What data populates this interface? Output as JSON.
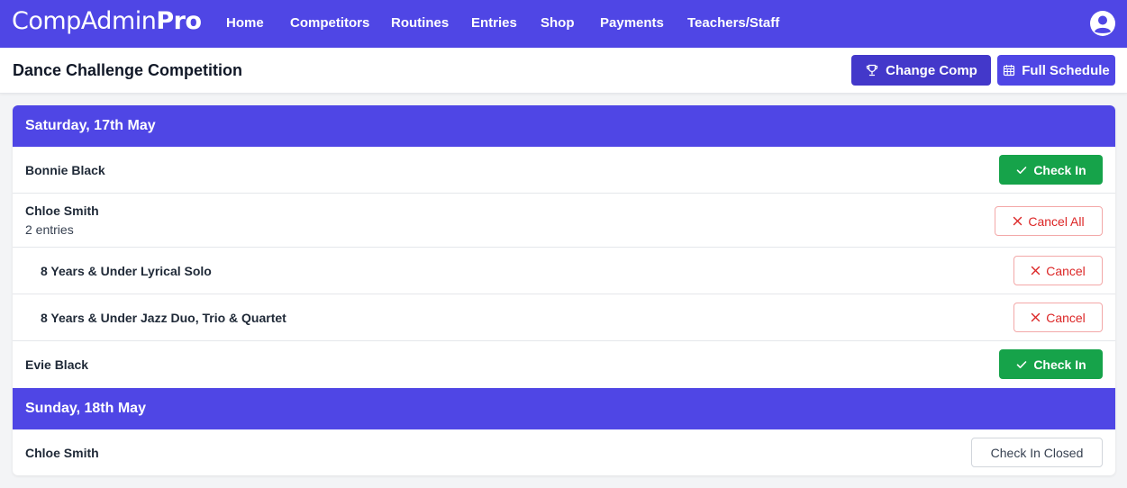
{
  "app": {
    "logo_main": "CompAdmin",
    "logo_bold": "Pro"
  },
  "nav": {
    "items": [
      "Home",
      "Competitors",
      "Routines",
      "Entries",
      "Shop",
      "Payments",
      "Teachers/Staff"
    ]
  },
  "header": {
    "title": "Dance Challenge Competition",
    "change_comp": "Change Comp",
    "full_schedule": "Full Schedule"
  },
  "days": [
    {
      "title": "Saturday, 17th May",
      "rows": [
        {
          "name": "Bonnie Black",
          "action": "Check In"
        },
        {
          "name": "Chloe Smith",
          "sub": "2 entries",
          "action": "Cancel All"
        },
        {
          "entry": "8 Years & Under Lyrical Solo",
          "action": "Cancel"
        },
        {
          "entry": "8 Years & Under Jazz Duo, Trio & Quartet",
          "action": "Cancel"
        },
        {
          "name": "Evie Black",
          "action": "Check In"
        }
      ]
    },
    {
      "title": "Sunday, 18th May",
      "rows": [
        {
          "name": "Chloe Smith",
          "action": "Check In Closed"
        }
      ]
    }
  ],
  "colors": {
    "primary": "#4f46e5",
    "primary_dark": "#4338ca",
    "success": "#16a34a",
    "danger": "#dc2626"
  }
}
